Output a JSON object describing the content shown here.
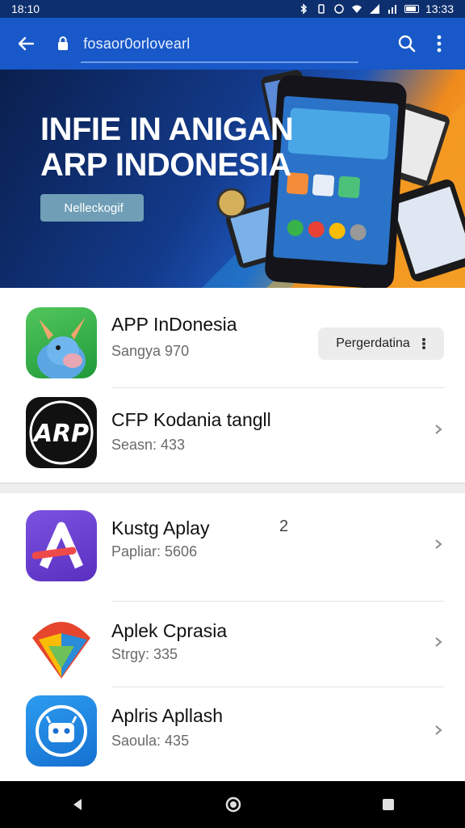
{
  "status_bar": {
    "time": "18:10",
    "right_time": "13:33"
  },
  "browser": {
    "url": " fosaor0orlovearl",
    "back_icon": "back-arrow-icon",
    "lock_icon": "lock-icon",
    "search_icon": "search-icon",
    "menu_icon": "more-vert-icon"
  },
  "banner": {
    "title_line1": "INFIE IN ANIGAN",
    "title_line2": "ARP INDONESIA",
    "button_label": " Nelleckogif"
  },
  "apps": [
    {
      "title": "APP InDonesia",
      "subtitle": "Sangya 970",
      "action_label": "Pergerdatina",
      "icon": "donkey-icon"
    },
    {
      "title": "CFP Kodania tangll",
      "subtitle": "Seasn: 433",
      "icon": "arp-logo-icon"
    },
    {
      "title": "Kustg Aplay",
      "badge": "2",
      "subtitle": "Papliar: 5606",
      "icon": "a-letter-icon"
    },
    {
      "title": "Aplek Cprasia",
      "subtitle": "Strgy: 335",
      "icon": "triangle-logo-icon"
    },
    {
      "title": "Aplris Apllash",
      "subtitle": "Saoula: 435",
      "icon": "robot-icon"
    }
  ],
  "colors": {
    "appbar": "#1858c8",
    "statusbar": "#0d2f6e"
  }
}
